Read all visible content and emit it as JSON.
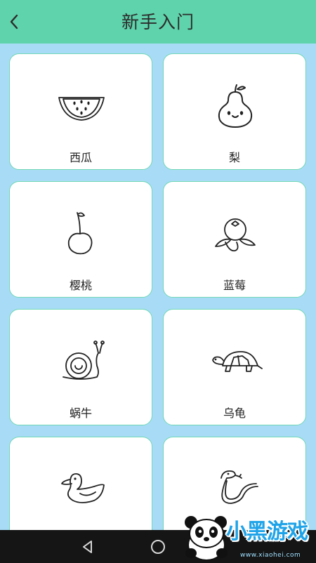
{
  "header": {
    "title": "新手入门",
    "back_icon": "chevron-left-icon"
  },
  "cards": [
    {
      "label": "西瓜",
      "icon": "watermelon-drawing"
    },
    {
      "label": "梨",
      "icon": "pear-drawing"
    },
    {
      "label": "樱桃",
      "icon": "cherry-drawing"
    },
    {
      "label": "蓝莓",
      "icon": "blueberry-drawing"
    },
    {
      "label": "蜗牛",
      "icon": "snail-drawing"
    },
    {
      "label": "乌龟",
      "icon": "turtle-drawing"
    },
    {
      "label": "",
      "icon": "duck-drawing"
    },
    {
      "label": "",
      "icon": "snake-drawing"
    }
  ],
  "watermark": {
    "brand": "小黑游戏",
    "site": "www.xiaohei.com"
  },
  "colors": {
    "header": "#5fd3ab",
    "background": "#a8dcf6",
    "card_border": "#6fd6b6",
    "navbar": "#151515"
  }
}
